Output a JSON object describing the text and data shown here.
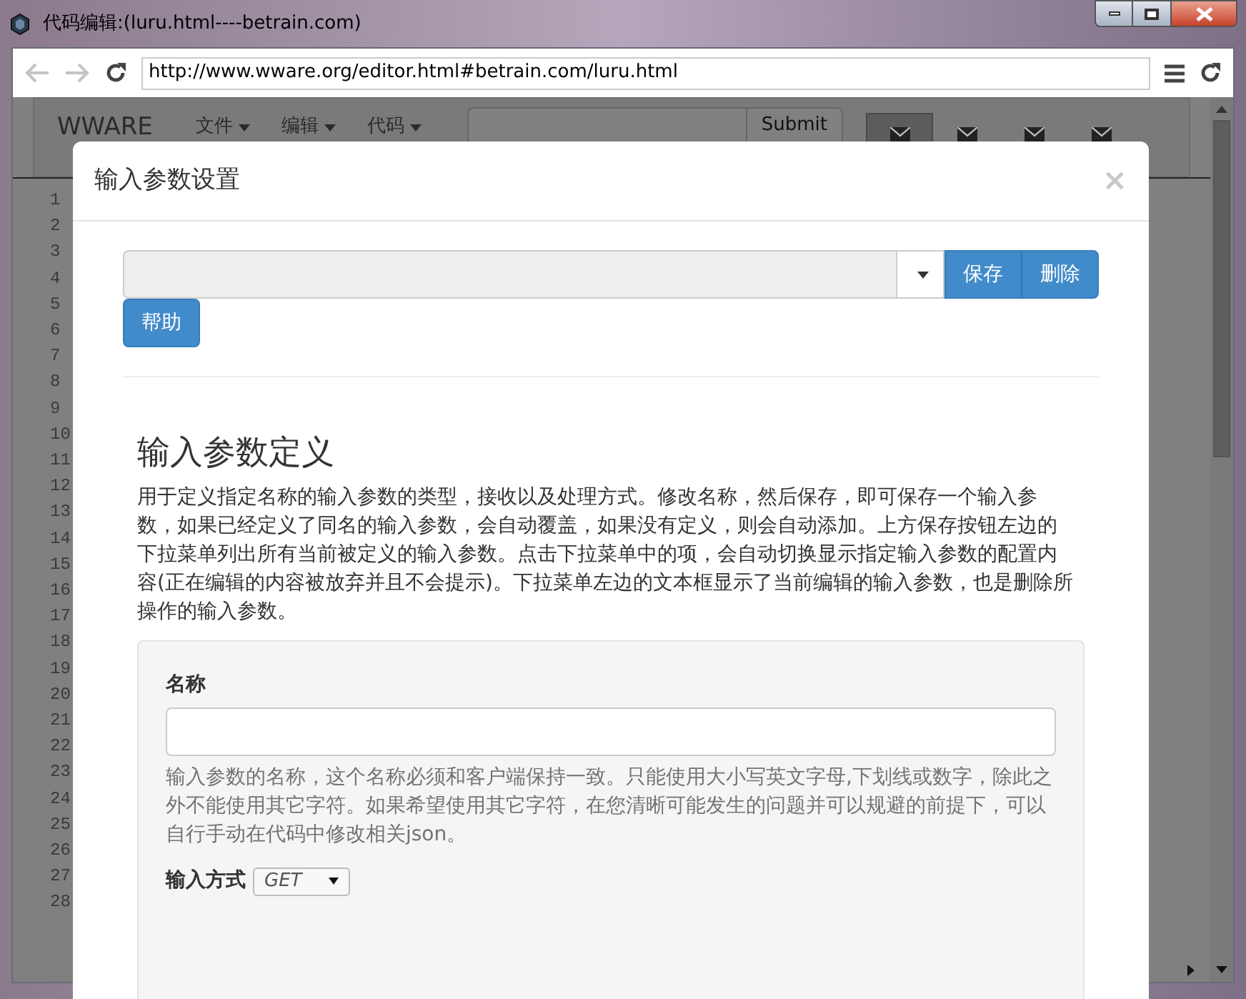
{
  "window": {
    "title": "代码编辑:(luru.html----betrain.com)"
  },
  "browser": {
    "url": "http://www.wware.org/editor.html#betrain.com/luru.html"
  },
  "navbar": {
    "brand": "WWARE",
    "menus": [
      {
        "label": "文件"
      },
      {
        "label": "编辑"
      },
      {
        "label": "代码"
      }
    ],
    "submit": "Submit",
    "icon_tabs": [
      {
        "selected": true
      },
      {
        "selected": false
      },
      {
        "selected": false
      },
      {
        "selected": false
      }
    ]
  },
  "line_numbers": [
    "1",
    "2",
    "3",
    "4",
    "5",
    "6",
    "7",
    "8",
    "9",
    "10",
    "11",
    "12",
    "13",
    "14",
    "15",
    "16",
    "17",
    "18",
    "19",
    "20",
    "21",
    "22",
    "23",
    "24",
    "25",
    "26",
    "27",
    "28"
  ],
  "dialog": {
    "title": "输入参数设置",
    "close": "×",
    "buttons": [
      {
        "label": "保存"
      },
      {
        "label": "删除"
      }
    ],
    "help_button": "帮助",
    "section_title": "输入参数定义",
    "description": "用于定义指定名称的输入参数的类型，接收以及处理方式。修改名称，然后保存，即可保存一个输入参数，如果已经定义了同名的输入参数，会自动覆盖，如果没有定义，则会自动添加。上方保存按钮左边的下拉菜单列出所有当前被定义的输入参数。点击下拉菜单中的项，会自动切换显示指定输入参数的配置内容(正在编辑的内容被放弃并且不会提示)。下拉菜单左边的文本框显示了当前编辑的输入参数，也是删除所操作的输入参数。",
    "name_label": "名称",
    "name_help": "输入参数的名称，这个名称必须和客户端保持一致。只能使用大小写英文字母,下划线或数字，除此之外不能使用其它字符。如果希望使用其它字符，在您清晰可能发生的问题并可以规避的前提下，可以自行手动在代码中修改相关json。",
    "method_label": "输入方式",
    "method_value": "GET"
  }
}
